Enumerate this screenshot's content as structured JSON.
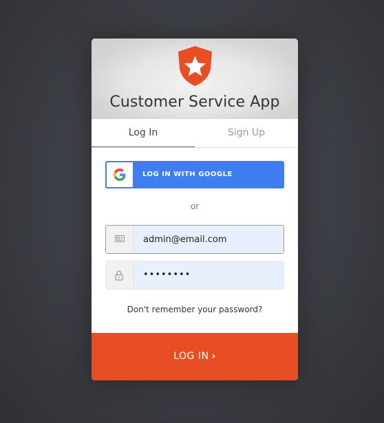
{
  "app": {
    "title": "Customer Service App",
    "brand_color": "#e84e23"
  },
  "tabs": [
    {
      "label": "Log In",
      "active": true
    },
    {
      "label": "Sign Up",
      "active": false
    }
  ],
  "social": {
    "google_label": "LOG IN WITH GOOGLE",
    "google_color": "#3f7ef0"
  },
  "separator": "or",
  "form": {
    "email": {
      "value": "admin@email.com",
      "icon": "envelope-icon"
    },
    "password": {
      "value": "••••••••",
      "icon": "lock-icon"
    }
  },
  "forgot_password": "Don't remember your password?",
  "submit": {
    "label": "LOG IN",
    "icon": "chevron-right-icon"
  }
}
